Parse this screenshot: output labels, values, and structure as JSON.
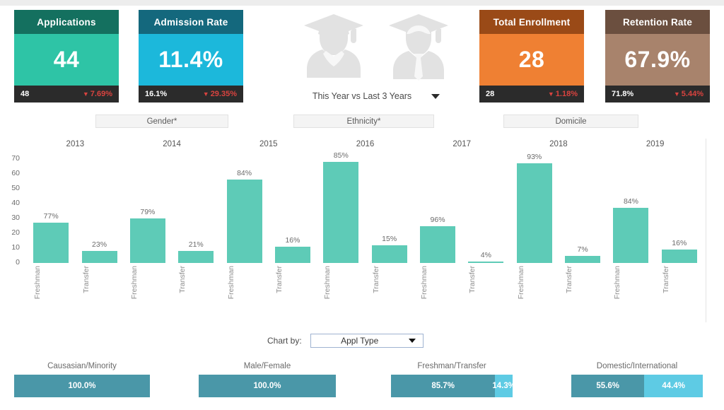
{
  "kpis": [
    {
      "id": "applications",
      "title": "Applications",
      "value": "44",
      "prev": "48",
      "delta": "7.69%",
      "direction": "down",
      "head_color": "#14705f",
      "body_color": "#2ec4a6"
    },
    {
      "id": "admission",
      "title": "Admission Rate",
      "value": "11.4%",
      "prev": "16.1%",
      "delta": "29.35%",
      "direction": "down",
      "head_color": "#14687d",
      "body_color": "#1cb8db"
    },
    {
      "id": "enrollment",
      "title": "Total Enrollment",
      "value": "28",
      "prev": "28",
      "delta": "1.18%",
      "direction": "down",
      "head_color": "#9a4a17",
      "body_color": "#ef8033"
    },
    {
      "id": "retention",
      "title": "Retention Rate",
      "value": "67.9%",
      "prev": "71.8%",
      "delta": "5.44%",
      "direction": "down",
      "head_color": "#6b4f3f",
      "body_color": "#a8836c"
    }
  ],
  "delta_arrow": "▼",
  "year_selector": {
    "label": "This Year vs Last 3 Years"
  },
  "tabs": [
    {
      "id": "gender",
      "label": "Gender*"
    },
    {
      "id": "ethnicity",
      "label": "Ethnicity*"
    },
    {
      "id": "domicile",
      "label": "Domicile"
    }
  ],
  "chart_by": {
    "label": "Chart by:",
    "value": "Appl Type"
  },
  "chart_data": {
    "type": "bar",
    "title": "",
    "xlabel": "",
    "ylabel": "",
    "ylim": [
      0,
      70
    ],
    "yticks": [
      0,
      10,
      20,
      30,
      40,
      50,
      60,
      70
    ],
    "grid": false,
    "legend": "none",
    "bar_color": "#5ecbb7",
    "group_labels": [
      "2013",
      "2014",
      "2015",
      "2016",
      "2017",
      "2018",
      "2019"
    ],
    "categories": [
      "Freshman",
      "Transfer"
    ],
    "bars": [
      {
        "group": "2013",
        "category": "Freshman",
        "value": 27,
        "label": "77%"
      },
      {
        "group": "2013",
        "category": "Transfer",
        "value": 8,
        "label": "23%"
      },
      {
        "group": "2014",
        "category": "Freshman",
        "value": 30,
        "label": "79%"
      },
      {
        "group": "2014",
        "category": "Transfer",
        "value": 8,
        "label": "21%"
      },
      {
        "group": "2015",
        "category": "Freshman",
        "value": 56,
        "label": "84%"
      },
      {
        "group": "2015",
        "category": "Transfer",
        "value": 11,
        "label": "16%"
      },
      {
        "group": "2016",
        "category": "Freshman",
        "value": 68,
        "label": "85%"
      },
      {
        "group": "2016",
        "category": "Transfer",
        "value": 12,
        "label": "15%"
      },
      {
        "group": "2017",
        "category": "Freshman",
        "value": 25,
        "label": "96%"
      },
      {
        "group": "2017",
        "category": "Transfer",
        "value": 1,
        "label": "4%"
      },
      {
        "group": "2018",
        "category": "Freshman",
        "value": 67,
        "label": "93%"
      },
      {
        "group": "2018",
        "category": "Transfer",
        "value": 5,
        "label": "7%"
      },
      {
        "group": "2019",
        "category": "Freshman",
        "value": 37,
        "label": "84%"
      },
      {
        "group": "2019",
        "category": "Transfer",
        "value": 9,
        "label": "16%"
      }
    ]
  },
  "splits": [
    {
      "id": "ethnicity",
      "title": "Causasian/Minority",
      "segments": [
        {
          "label": "100.0%",
          "pct": 100,
          "color": "#4a97a8"
        }
      ]
    },
    {
      "id": "gender",
      "title": "Male/Female",
      "segments": [
        {
          "label": "100.0%",
          "pct": 100,
          "color": "#4a97a8"
        }
      ]
    },
    {
      "id": "appltype",
      "title": "Freshman/Transfer",
      "segments": [
        {
          "label": "85.7%",
          "pct": 85.7,
          "color": "#4a97a8"
        },
        {
          "label": "14.3%",
          "pct": 14.3,
          "color": "#5ecbe4"
        }
      ]
    },
    {
      "id": "domicile",
      "title": "Domestic/International",
      "segments": [
        {
          "label": "55.6%",
          "pct": 55.6,
          "color": "#4a97a8"
        },
        {
          "label": "44.4%",
          "pct": 44.4,
          "color": "#5ecbe4"
        }
      ]
    }
  ],
  "icons": {
    "female_graduate": "female-graduate-icon",
    "male_graduate": "male-graduate-icon"
  }
}
